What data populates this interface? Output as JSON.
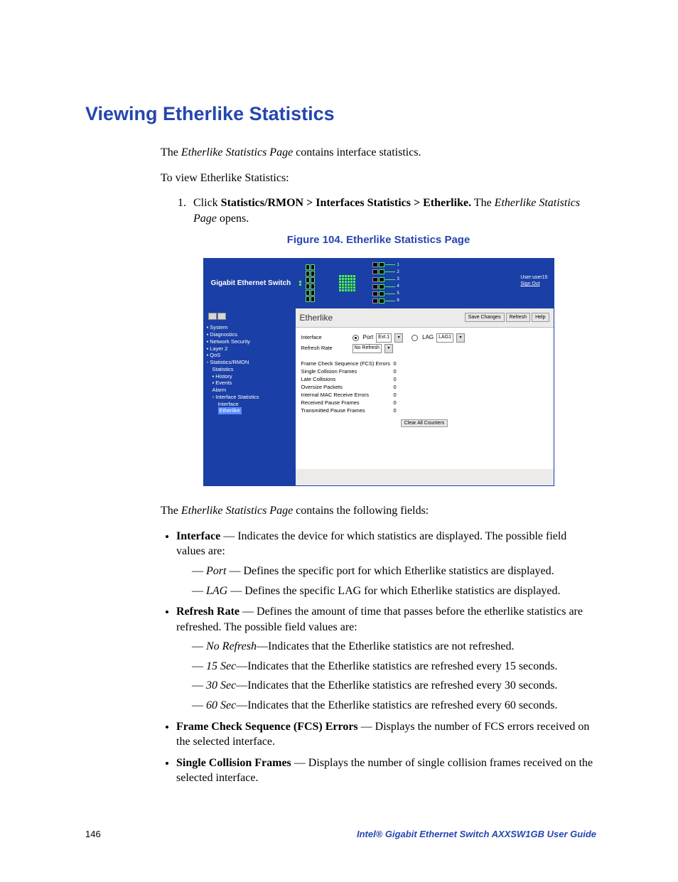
{
  "heading": "Viewing Etherlike Statistics",
  "intro1_a": "The ",
  "intro1_b": "Etherlike Statistics Page",
  "intro1_c": " contains interface statistics.",
  "intro2": "To view Etherlike Statistics:",
  "step1_a": "Click ",
  "step1_b": "Statistics/RMON > Interfaces Statistics > Etherlike.",
  "step1_c": " The ",
  "step1_d": "Etherlike Statistics Page",
  "step1_e": " opens.",
  "fig_caption": "Figure 104. Etherlike Statistics Page",
  "fig": {
    "banner_title": "Gigabit Ethernet Switch",
    "user_label": "User:user15",
    "signout": "Sign Out",
    "tree": {
      "system": "System",
      "diagnostics": "Diagnostics",
      "network_security": "Network Security",
      "layer2": "Layer 2",
      "qos": "QoS",
      "stats_rmon": "Statistics/RMON",
      "statistics": "Statistics",
      "history": "History",
      "events": "Events",
      "alarm": "Alarm",
      "iface_stats": "Interface Statistics",
      "interface": "Interface",
      "etherlike": "Etherlike"
    },
    "page_title": "Etherlike",
    "buttons": {
      "save": "Save Changes",
      "refresh": "Refresh",
      "help": "Help",
      "clear_all": "Clear All Counters"
    },
    "form": {
      "interface_lbl": "Interface",
      "port_lbl": "Port",
      "port_val": "Ext.1",
      "lag_lbl": "LAG",
      "lag_val": "LAG1",
      "refresh_lbl": "Refresh Rate",
      "refresh_val": "No Refresh"
    },
    "stats": [
      {
        "k": "Frame Check Sequence (FCS) Errors",
        "v": "0"
      },
      {
        "k": "Single Collision Frames",
        "v": "0"
      },
      {
        "k": "Late Collisions",
        "v": "0"
      },
      {
        "k": "Oversize Packets",
        "v": "0"
      },
      {
        "k": "Internal MAC Receive Errors",
        "v": "0"
      },
      {
        "k": "Received Pause Frames",
        "v": "0"
      },
      {
        "k": "Transmitted Pause Frames",
        "v": "0"
      }
    ]
  },
  "after_fig_a": "The ",
  "after_fig_b": "Etherlike Statistics Page",
  "after_fig_c": " contains the following fields:",
  "fields": {
    "interface": {
      "name": "Interface",
      "desc": " — Indicates the device for which statistics are displayed. The possible field values are:",
      "port_name": "Port",
      "port_desc": " — Defines the specific port for which Etherlike statistics are displayed.",
      "lag_name": "LAG",
      "lag_desc": " — Defines the specific LAG for which Etherlike statistics are displayed."
    },
    "refresh": {
      "name": "Refresh Rate",
      "desc": " — Defines the amount of time that passes before the etherlike statistics are refreshed. The possible field values are:",
      "no_name": "No Refresh",
      "no_desc": "—Indicates that the Etherlike statistics are not refreshed.",
      "s15_name": "15 Sec",
      "s15_desc": "—Indicates that the Etherlike statistics are refreshed every 15 seconds.",
      "s30_name": "30 Sec",
      "s30_desc": "—Indicates that the Etherlike statistics are refreshed every 30 seconds.",
      "s60_name": "60 Sec",
      "s60_desc": "—Indicates that the Etherlike statistics are refreshed every 60 seconds."
    },
    "fcs": {
      "name": "Frame Check Sequence (FCS) Errors",
      "desc": " — Displays the number of FCS errors received on the selected interface."
    },
    "single": {
      "name": "Single Collision Frames",
      "desc": " — Displays the number of single collision frames received on the selected interface."
    }
  },
  "footer": {
    "page": "146",
    "guide": "Intel® Gigabit Ethernet Switch AXXSW1GB User Guide"
  }
}
